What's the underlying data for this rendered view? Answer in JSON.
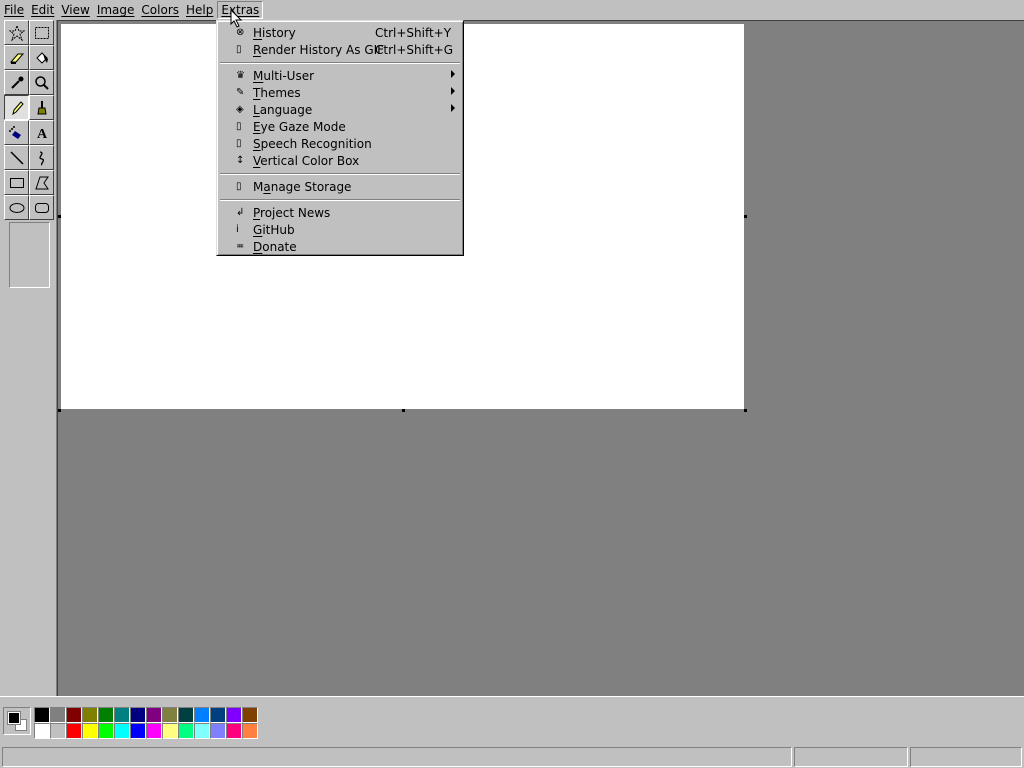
{
  "menubar": {
    "items": [
      "File",
      "Edit",
      "View",
      "Image",
      "Colors",
      "Help",
      "Extras"
    ],
    "open": "Extras"
  },
  "tools": [
    {
      "name": "free-form-select-tool",
      "icon": "star-select-icon"
    },
    {
      "name": "select-tool",
      "icon": "rect-select-icon"
    },
    {
      "name": "eraser-tool",
      "icon": "eraser-icon"
    },
    {
      "name": "fill-tool",
      "icon": "paint-bucket-icon"
    },
    {
      "name": "pick-color-tool",
      "icon": "eyedropper-icon"
    },
    {
      "name": "magnifier-tool",
      "icon": "magnifier-icon"
    },
    {
      "name": "pencil-tool",
      "icon": "pencil-icon",
      "pressed": true
    },
    {
      "name": "brush-tool",
      "icon": "brush-icon"
    },
    {
      "name": "airbrush-tool",
      "icon": "airbrush-icon"
    },
    {
      "name": "text-tool",
      "icon": "text-icon"
    },
    {
      "name": "line-tool",
      "icon": "line-icon"
    },
    {
      "name": "curve-tool",
      "icon": "curve-icon"
    },
    {
      "name": "rectangle-tool",
      "icon": "rectangle-icon"
    },
    {
      "name": "polygon-tool",
      "icon": "polygon-icon"
    },
    {
      "name": "ellipse-tool",
      "icon": "ellipse-icon"
    },
    {
      "name": "rounded-rectangle-tool",
      "icon": "rounded-rectangle-icon"
    }
  ],
  "extras_menu": {
    "items": [
      {
        "icon": "⊗",
        "icon_name": "history-icon",
        "label": "History",
        "accel": "H",
        "shortcut": "Ctrl+Shift+Y"
      },
      {
        "icon": "▯",
        "icon_name": "gif-icon",
        "label": "Render History As GIF",
        "accel": "R",
        "shortcut": "Ctrl+Shift+G"
      },
      {
        "separator": true
      },
      {
        "icon": "♛",
        "icon_name": "multi-user-icon",
        "label": "Multi-User",
        "accel": "M",
        "submenu": true
      },
      {
        "icon": "✎",
        "icon_name": "brush-theme-icon",
        "label": "Themes",
        "accel": "T",
        "submenu": true
      },
      {
        "icon": "◈",
        "icon_name": "globe-icon",
        "label": "Language",
        "accel": "L",
        "submenu": true
      },
      {
        "icon": "▯",
        "icon_name": "eye-icon",
        "label": "Eye Gaze Mode",
        "accel": "E"
      },
      {
        "icon": "▯",
        "icon_name": "microphone-icon",
        "label": "Speech Recognition",
        "accel": "S"
      },
      {
        "icon": "↕",
        "icon_name": "vertical-arrows-icon",
        "label": "Vertical Color Box",
        "accel": "V"
      },
      {
        "separator": true
      },
      {
        "icon": "▯",
        "icon_name": "storage-icon",
        "label": "Manage Storage",
        "accel": "a"
      },
      {
        "separator": true
      },
      {
        "icon": "↲",
        "icon_name": "news-icon",
        "label": "Project News",
        "accel": "P"
      },
      {
        "icon": "ⅰ",
        "icon_name": "github-icon",
        "label": "GitHub",
        "accel": "G"
      },
      {
        "icon": "≖",
        "icon_name": "donate-icon",
        "label": "Donate",
        "accel": "D"
      }
    ]
  },
  "colors": {
    "foreground": "#000000",
    "background": "#ffffff",
    "palette": [
      "#000000",
      "#808080",
      "#800000",
      "#808000",
      "#008000",
      "#008080",
      "#000080",
      "#800080",
      "#808040",
      "#004040",
      "#0080ff",
      "#004080",
      "#8000ff",
      "#804000",
      "#ffffff",
      "#c0c0c0",
      "#ff0000",
      "#ffff00",
      "#00ff00",
      "#00ffff",
      "#0000ff",
      "#ff00ff",
      "#ffff80",
      "#00ff80",
      "#80ffff",
      "#8080ff",
      "#ff0080",
      "#ff8040"
    ]
  },
  "statusbar": {
    "text": "",
    "position": "",
    "size": ""
  }
}
